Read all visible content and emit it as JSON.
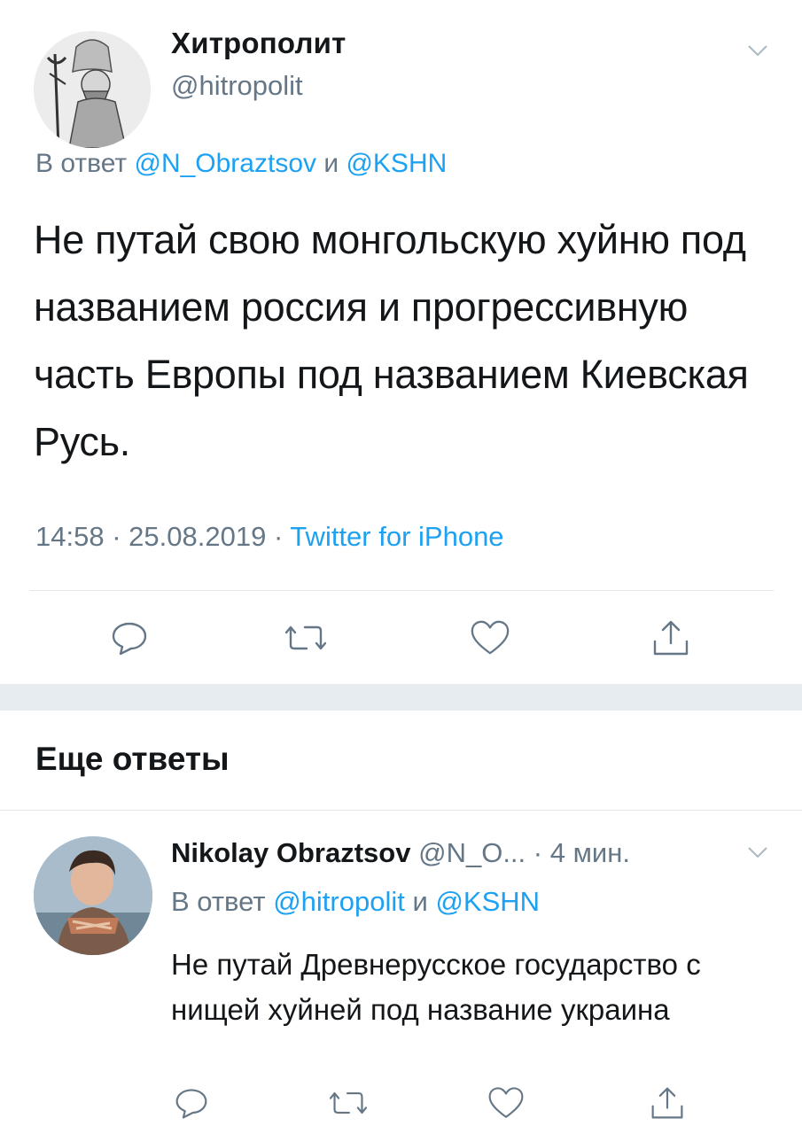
{
  "main_tweet": {
    "author_name": "Хитрополит",
    "author_handle": "@hitropolit",
    "reply_prefix": "В ответ",
    "reply_user1": "@N_Obraztsov",
    "reply_and": "и",
    "reply_user2": "@KSHN",
    "text": "Не путай свою монгольскую хуйню под названием россия и прогрессивную часть Европы под названием Киевская Русь.",
    "time": "14:58",
    "date": "25.08.2019",
    "source": "Twitter for iPhone",
    "separator": "·"
  },
  "section": {
    "title": "Еще ответы"
  },
  "reply_tweet": {
    "author_name": "Nikolay Obraztsov",
    "author_handle": "@N_O...",
    "time_ago": "· 4 мин.",
    "reply_prefix": "В ответ",
    "reply_user1": "@hitropolit",
    "reply_and": "и",
    "reply_user2": "@KSHN",
    "text": "Не путай Древнерусское государство с нищей хуйней под название украина"
  },
  "colors": {
    "link": "#1da1f2",
    "secondary_text": "#657786",
    "primary_text": "#14171a",
    "divider": "#e1e8ed",
    "band": "#e6ecf0"
  },
  "icons": [
    "chevron-down-icon",
    "reply-icon",
    "retweet-icon",
    "like-icon",
    "share-icon"
  ]
}
